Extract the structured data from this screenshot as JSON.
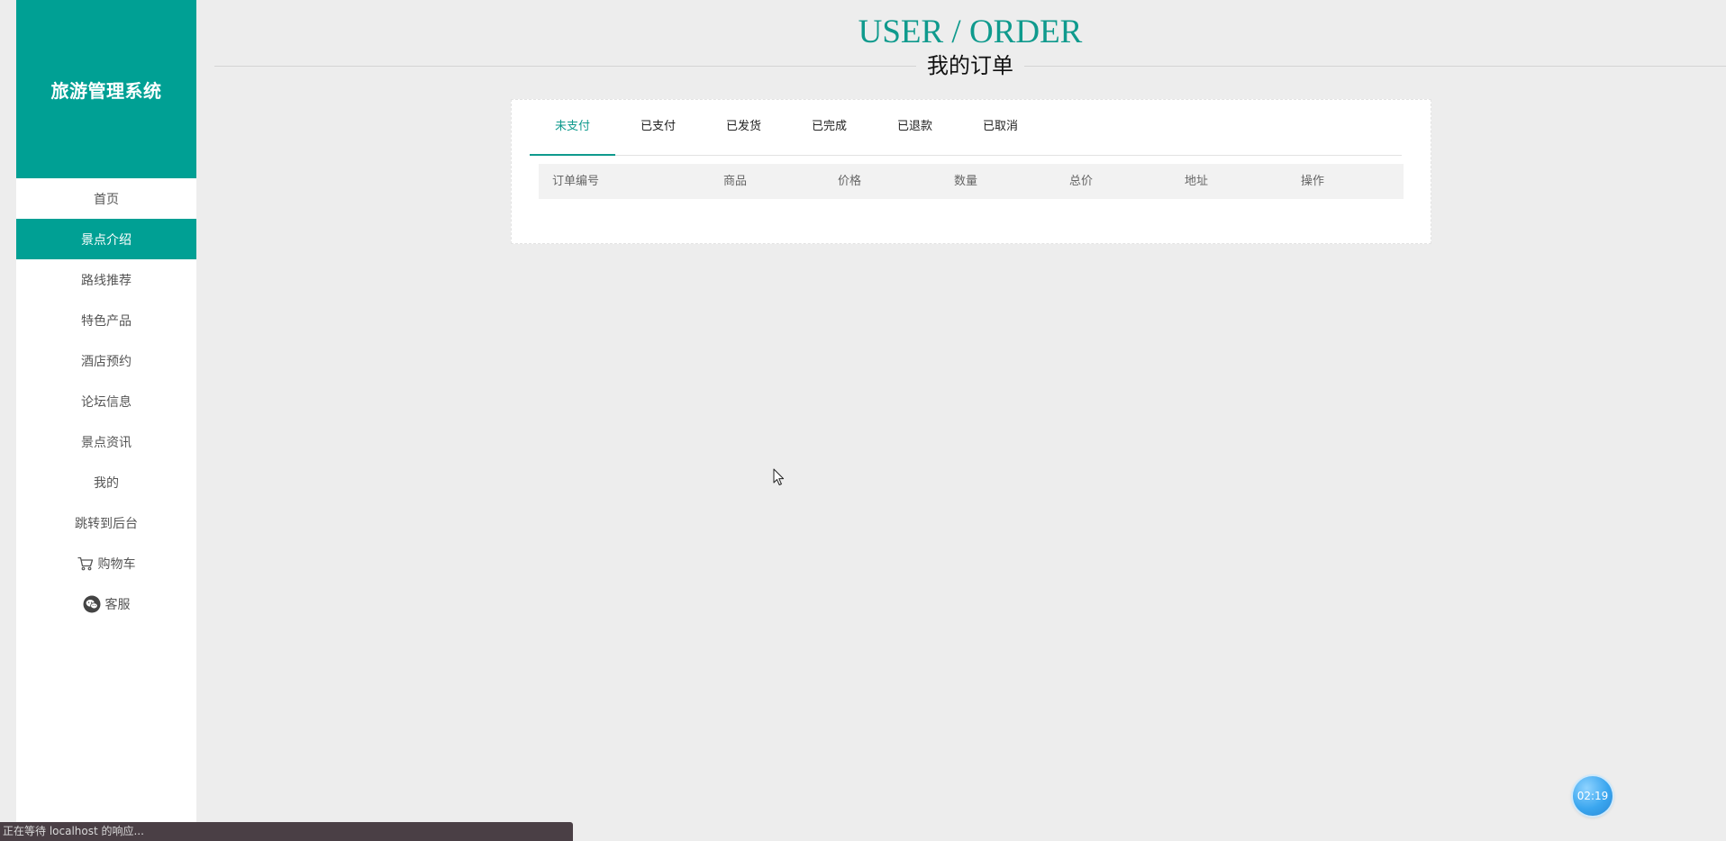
{
  "sidebar": {
    "brand": "旅游管理系统",
    "items": [
      {
        "label": "首页"
      },
      {
        "label": "景点介绍"
      },
      {
        "label": "路线推荐"
      },
      {
        "label": "特色产品"
      },
      {
        "label": "酒店预约"
      },
      {
        "label": "论坛信息"
      },
      {
        "label": "景点资讯"
      },
      {
        "label": "我的"
      },
      {
        "label": "跳转到后台"
      },
      {
        "label": "购物车",
        "icon": "cart-icon"
      },
      {
        "label": "客服",
        "icon": "wechat-icon"
      }
    ],
    "active_index": 1
  },
  "header": {
    "title_en": "USER / ORDER",
    "title_cn": "我的订单"
  },
  "orders": {
    "tabs": [
      "未支付",
      "已支付",
      "已发货",
      "已完成",
      "已退款",
      "已取消"
    ],
    "active_tab": 0,
    "columns": [
      "订单编号",
      "商品",
      "价格",
      "数量",
      "总价",
      "地址",
      "操作"
    ],
    "rows": []
  },
  "status_bar": {
    "text": "正在等待 localhost 的响应..."
  },
  "timer": {
    "text": "02:19"
  },
  "colors": {
    "accent": "#00a094",
    "background": "#ededed"
  }
}
